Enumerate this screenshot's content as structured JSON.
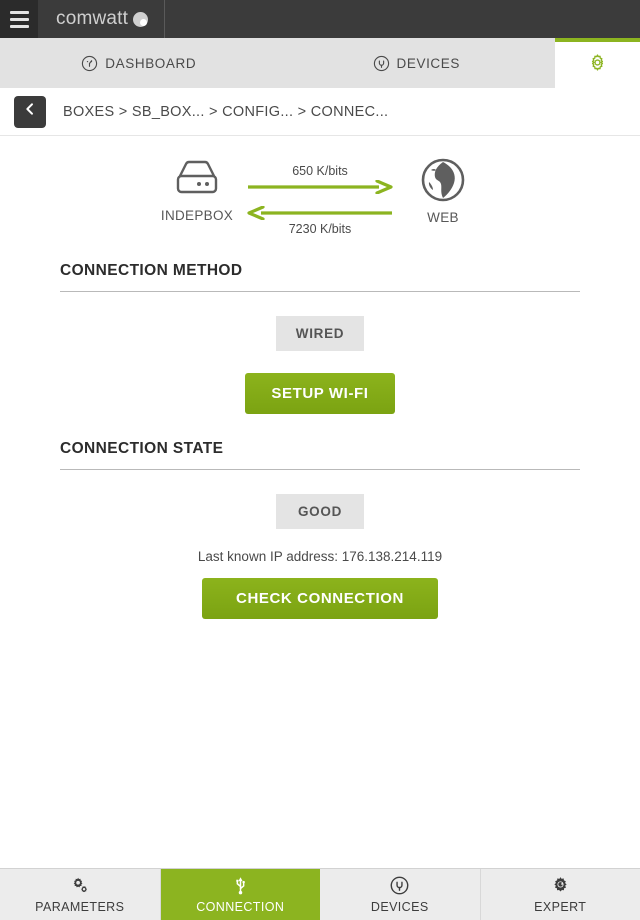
{
  "header": {
    "menu_icon": "hamburger-icon",
    "brand": "comwatt",
    "brand_mark_icon": "comwatt-logo-icon"
  },
  "tabs": [
    {
      "label": "DASHBOARD",
      "icon": "dashboard-gauge-icon",
      "active": false
    },
    {
      "label": "DEVICES",
      "icon": "plug-icon",
      "active": false
    }
  ],
  "settings": {
    "icon": "gear-icon",
    "accent": "#8cb420"
  },
  "breadcrumb": {
    "back_icon": "chevron-left-icon",
    "path": "BOXES > SB_BOX...  > CONFIG...  > CONNEC..."
  },
  "diagram": {
    "left_node": {
      "label": "INDEPBOX",
      "icon": "server-box-icon"
    },
    "right_node": {
      "label": "WEB",
      "icon": "globe-icon"
    },
    "upload_label": "650 K/bits",
    "download_label": "7230 K/bits",
    "arrow_color": "#8cb420"
  },
  "connection_method": {
    "title": "CONNECTION METHOD",
    "badge": "WIRED",
    "button": "SETUP WI-FI"
  },
  "connection_state": {
    "title": "CONNECTION STATE",
    "badge": "GOOD",
    "ip_text": "Last known IP address: 176.138.214.119",
    "button": "CHECK CONNECTION"
  },
  "bottom_nav": [
    {
      "label": "PARAMETERS",
      "icon": "gears-icon",
      "active": false
    },
    {
      "label": "CONNECTION",
      "icon": "usb-icon",
      "active": true
    },
    {
      "label": "DEVICES",
      "icon": "plug-icon",
      "active": false
    },
    {
      "label": "EXPERT",
      "icon": "gear-wrench-icon",
      "active": false
    }
  ],
  "colors": {
    "accent_green": "#8cb420",
    "dark_bar": "#3b3b3b",
    "badge_bg": "#e4e4e4"
  }
}
